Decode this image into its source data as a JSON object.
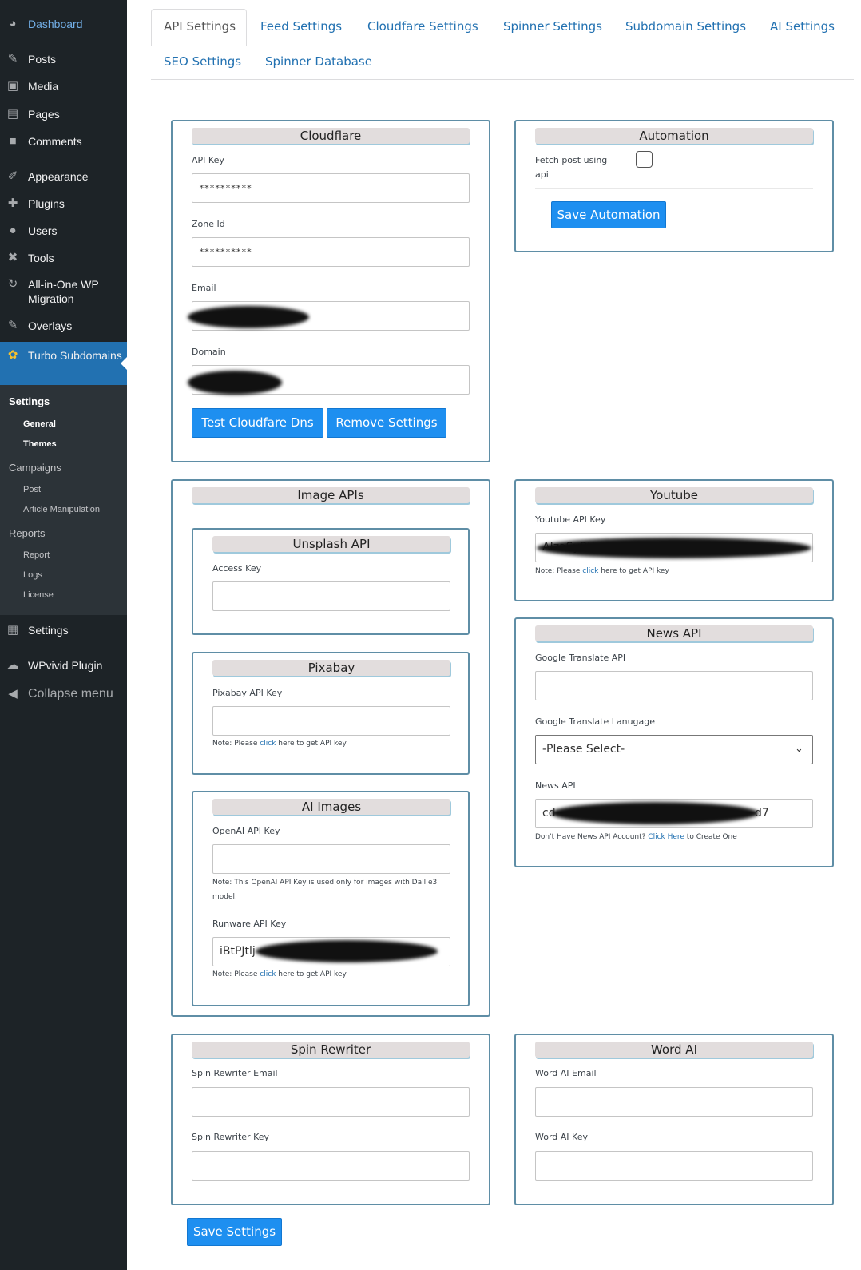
{
  "sidebar": {
    "dashboard": "Dashboard",
    "posts": "Posts",
    "media": "Media",
    "pages": "Pages",
    "comments": "Comments",
    "appearance": "Appearance",
    "plugins": "Plugins",
    "users": "Users",
    "tools": "Tools",
    "aiowp": "All-in-One WP Migration",
    "overlays": "Overlays",
    "turbo": "Turbo Subdomains",
    "settings_head": "Settings",
    "general": "General",
    "themes": "Themes",
    "campaigns": "Campaigns",
    "post": "Post",
    "article_manipulation": "Article Manipulation",
    "reports": "Reports",
    "report": "Report",
    "logs": "Logs",
    "license": "License",
    "settings": "Settings",
    "wpvivid": "WPvivid Plugin",
    "collapse": "Collapse menu"
  },
  "tabs": {
    "api": "API Settings",
    "feed": "Feed Settings",
    "cloudfare": "Cloudfare Settings",
    "spinner": "Spinner Settings",
    "subdomain": "Subdomain Settings",
    "ai": "AI Settings",
    "seo": "SEO Settings",
    "spinner_db": "Spinner Database"
  },
  "cloudflare": {
    "title": "Cloudflare",
    "api_key_label": "API Key",
    "api_key_value": "**********",
    "zone_label": "Zone Id",
    "zone_value": "**********",
    "email_label": "Email",
    "domain_label": "Domain",
    "test_btn": "Test Cloudfare Dns",
    "remove_btn": "Remove Settings"
  },
  "automation": {
    "title": "Automation",
    "fetch_label_1": "Fetch post using",
    "fetch_label_2": "api",
    "save_btn": "Save Automation"
  },
  "image_apis": {
    "title": "Image APIs",
    "unsplash": {
      "title": "Unsplash API",
      "access_label": "Access Key"
    },
    "pixabay": {
      "title": "Pixabay",
      "key_label": "Pixabay API Key",
      "note_pre": "Note: Please ",
      "note_link": "click",
      "note_post": " here to get API key"
    },
    "ai_images": {
      "title": "AI Images",
      "openai_label": "OpenAI API Key",
      "openai_note_1": "Note: This OpenAI API Key is used only for images with Dall.e3",
      "openai_note_2": "model.",
      "runware_label": "Runware API Key",
      "runware_value": "iBtPJtlj",
      "note_pre": "Note: Please ",
      "note_link": "click",
      "note_post": " here to get API key"
    }
  },
  "youtube": {
    "title": "Youtube",
    "key_label": "Youtube API Key",
    "key_value": "AIzaSyBtj",
    "note_pre": "Note: Please ",
    "note_link": "click",
    "note_post": " here to get API key"
  },
  "news": {
    "title": "News API",
    "translate_label": "Google Translate API",
    "language_label": "Google Translate Lanugage",
    "language_value": "-Please Select-",
    "news_label": "News API",
    "news_value_start": "cd",
    "news_value_end": "d7",
    "note_pre": "Don't Have News API Account? ",
    "note_link": "Click Here",
    "note_post": " to Create One"
  },
  "spin_rewriter": {
    "title": "Spin Rewriter",
    "email_label": "Spin Rewriter Email",
    "key_label": "Spin Rewriter Key"
  },
  "word_ai": {
    "title": "Word AI",
    "email_label": "Word AI Email",
    "key_label": "Word AI Key"
  },
  "save_settings": "Save Settings"
}
